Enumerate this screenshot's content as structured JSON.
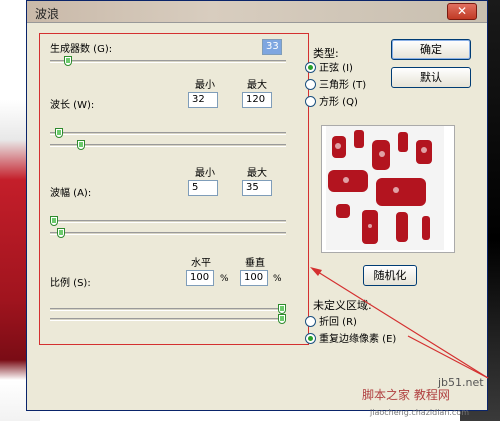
{
  "window": {
    "title": "波浪",
    "close_glyph": "✕"
  },
  "generators": {
    "label": "生成器数 (G):",
    "value": "33",
    "slider_fraction": 0.06
  },
  "wavelength": {
    "label": "波长 (W):",
    "min_label": "最小",
    "max_label": "最大",
    "min_value": "32",
    "max_value": "120",
    "slider_min_fraction": 0.02,
    "slider_max_fraction": 0.12
  },
  "amplitude": {
    "label": "波幅 (A):",
    "min_label": "最小",
    "max_label": "最大",
    "min_value": "5",
    "max_value": "35",
    "slider_min_fraction": 0.0,
    "slider_max_fraction": 0.03
  },
  "scale": {
    "label": "比例 (S):",
    "h_label": "水平",
    "v_label": "垂直",
    "h_value": "100",
    "v_value": "100",
    "unit": "%",
    "slider_h_fraction": 1.0,
    "slider_v_fraction": 1.0
  },
  "type": {
    "title": "类型:",
    "options": [
      {
        "label": "正弦 (I)",
        "selected": true
      },
      {
        "label": "三角形 (T)",
        "selected": false
      },
      {
        "label": "方形 (Q)",
        "selected": false
      }
    ]
  },
  "buttons": {
    "ok": "确定",
    "default": "默认",
    "randomize": "随机化"
  },
  "undefined_area": {
    "title": "未定义区域:",
    "options": [
      {
        "label": "折回 (R)",
        "selected": false
      },
      {
        "label": "重复边缘像素 (E)",
        "selected": true
      }
    ]
  },
  "watermark": {
    "site": "jb51.net",
    "text": "脚本之家 教程网",
    "url": "jiaocheng.chazidian.com"
  },
  "colors": {
    "accent_red": "#d43030",
    "slider_green": "#2e8b2e"
  }
}
